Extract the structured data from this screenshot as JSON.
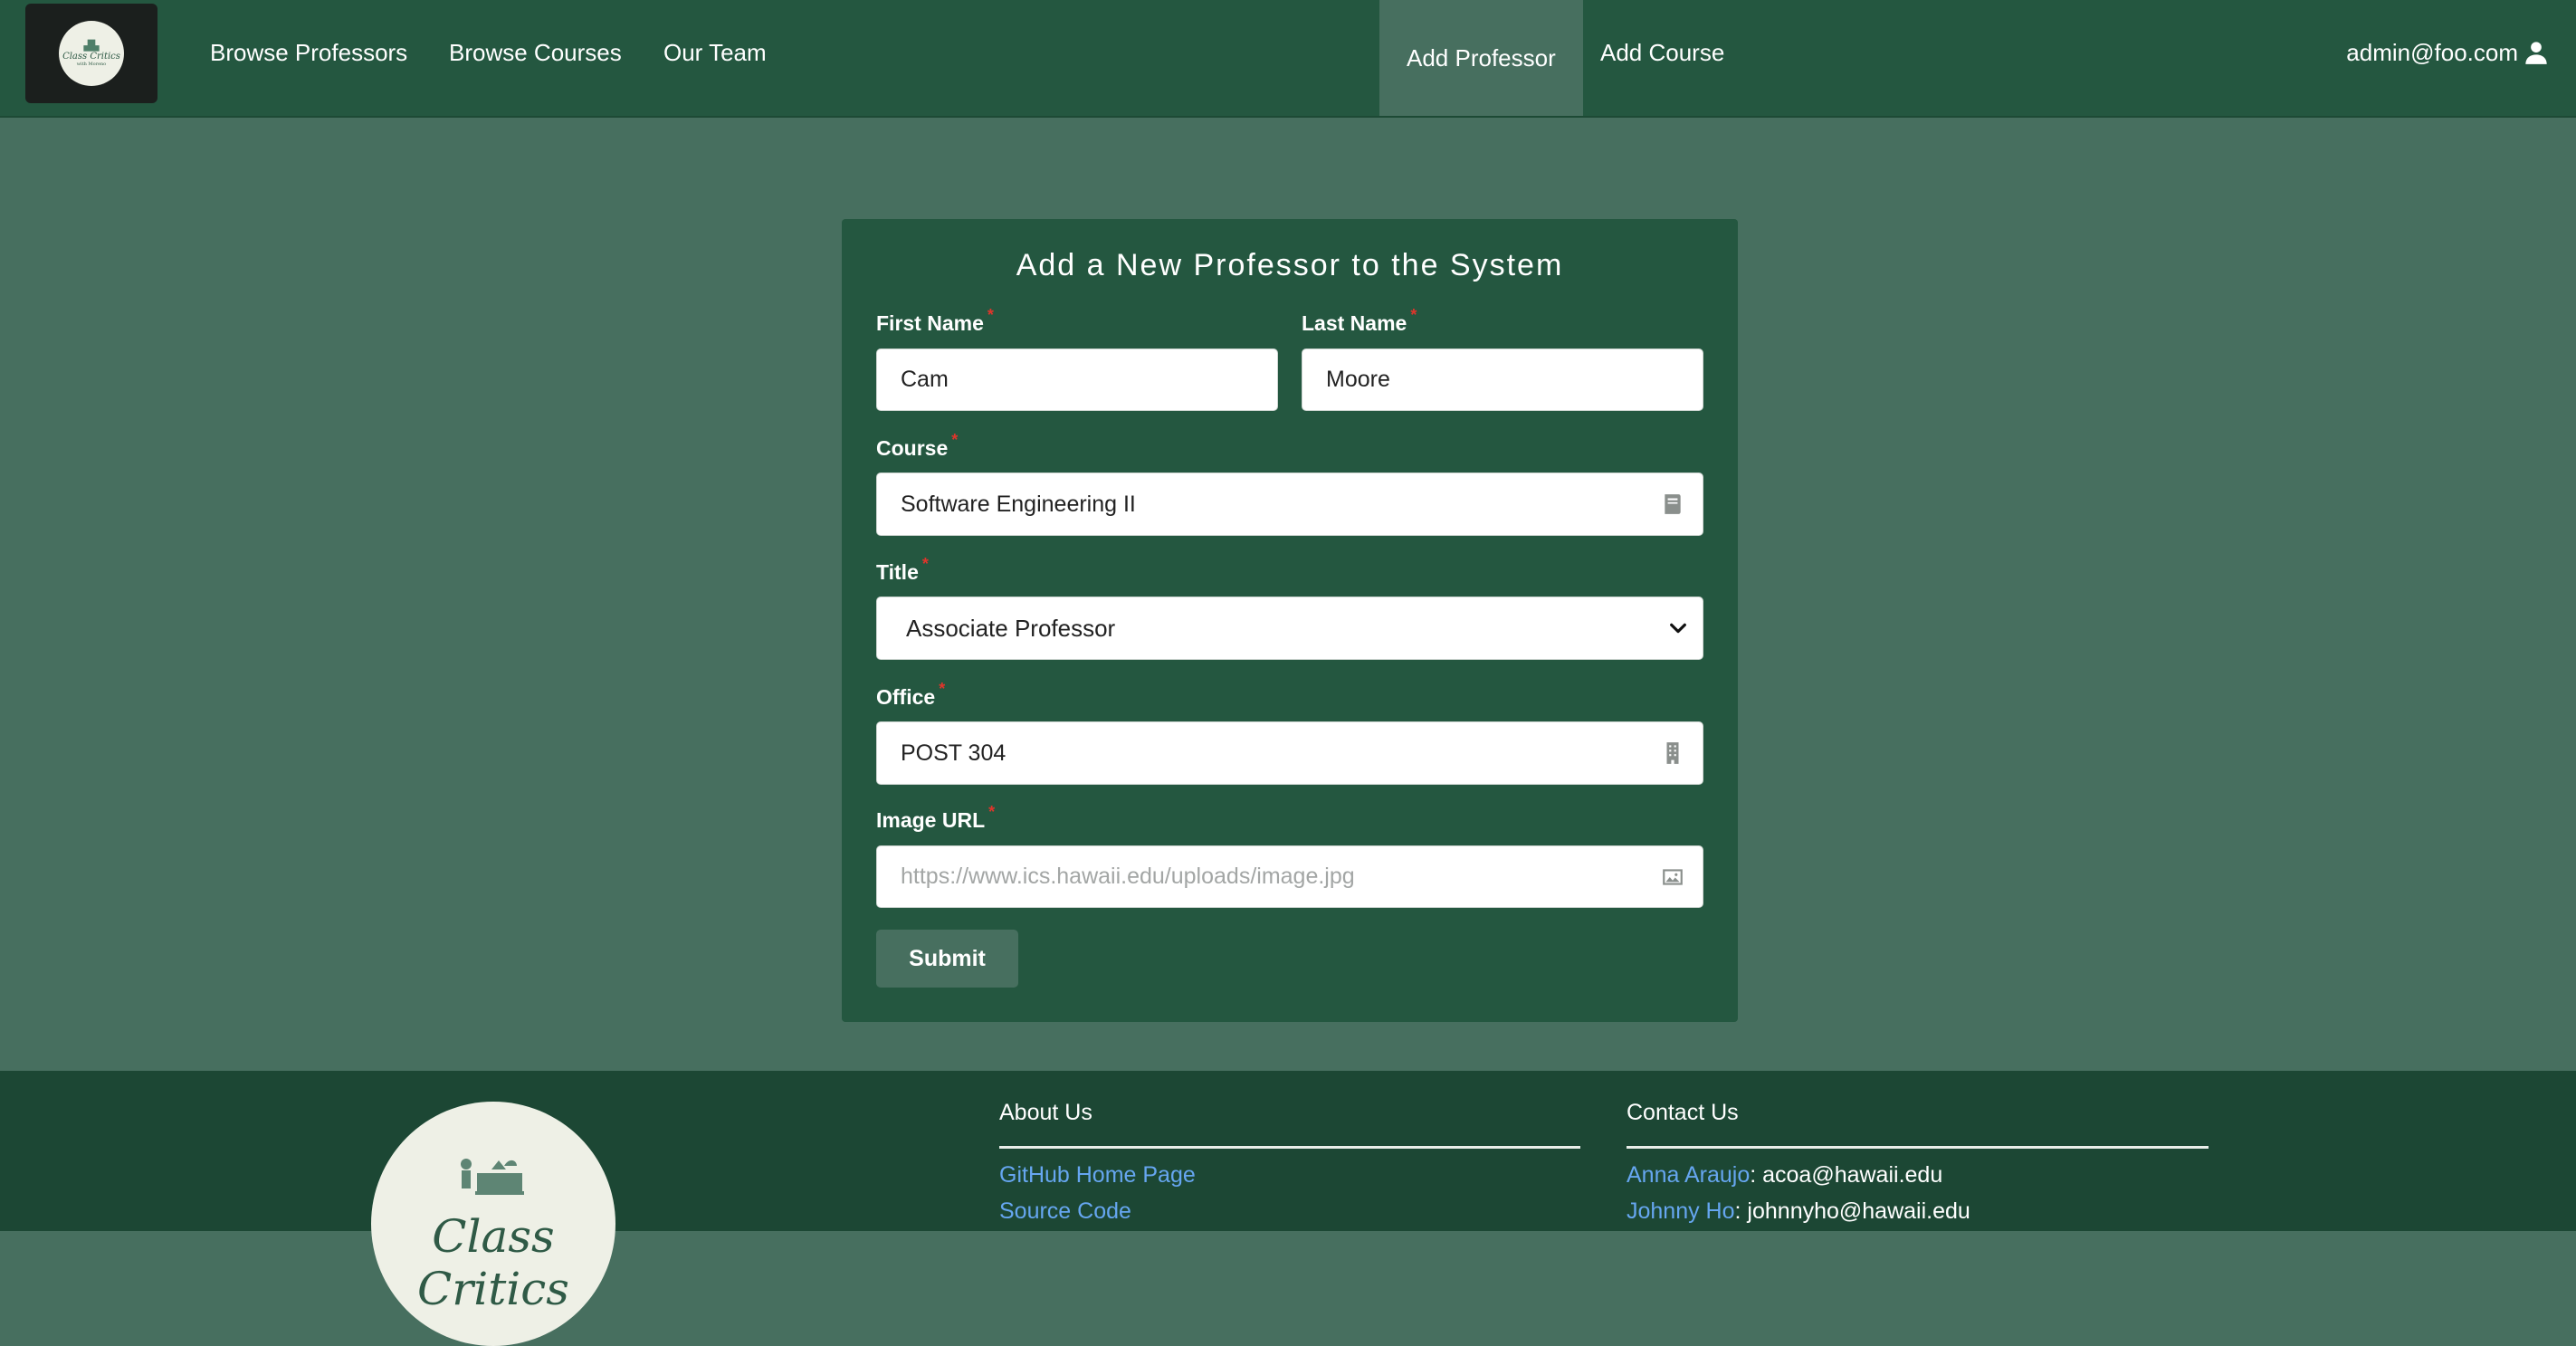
{
  "nav": {
    "logo_text": "Class Critics",
    "logo_sub": "with Moreno",
    "links": [
      "Browse Professors",
      "Browse Courses",
      "Our Team"
    ],
    "admin_links": [
      "Add Professor",
      "Add Course"
    ],
    "user": "admin@foo.com"
  },
  "form": {
    "title": "Add a New Professor to the System",
    "required_mark": "*",
    "first_name": {
      "label": "First Name",
      "value": "Cam"
    },
    "last_name": {
      "label": "Last Name",
      "value": "Moore"
    },
    "course": {
      "label": "Course",
      "value": "Software Engineering II",
      "icon": "book-icon"
    },
    "title_field": {
      "label": "Title",
      "value": "Associate Professor"
    },
    "office": {
      "label": "Office",
      "value": "POST 304",
      "icon": "building-icon"
    },
    "image_url": {
      "label": "Image URL",
      "value": "",
      "placeholder": "https://www.ics.hawaii.edu/uploads/image.jpg",
      "icon": "image-icon"
    },
    "submit_label": "Submit"
  },
  "footer": {
    "logo_text": "Class Critics",
    "about": {
      "heading": "About Us",
      "links": [
        "GitHub Home Page",
        "Source Code"
      ]
    },
    "contact": {
      "heading": "Contact Us",
      "people": [
        {
          "name": "Anna Araujo",
          "email": ": acoa@hawaii.edu"
        },
        {
          "name": "Johnny Ho",
          "email": ": johnnyho@hawaii.edu"
        }
      ]
    }
  },
  "colors": {
    "navbar": "#245740",
    "page": "#476f5f",
    "card": "#245740",
    "footer": "#1c4734",
    "link": "#66a6f0",
    "required": "#e0352b"
  }
}
